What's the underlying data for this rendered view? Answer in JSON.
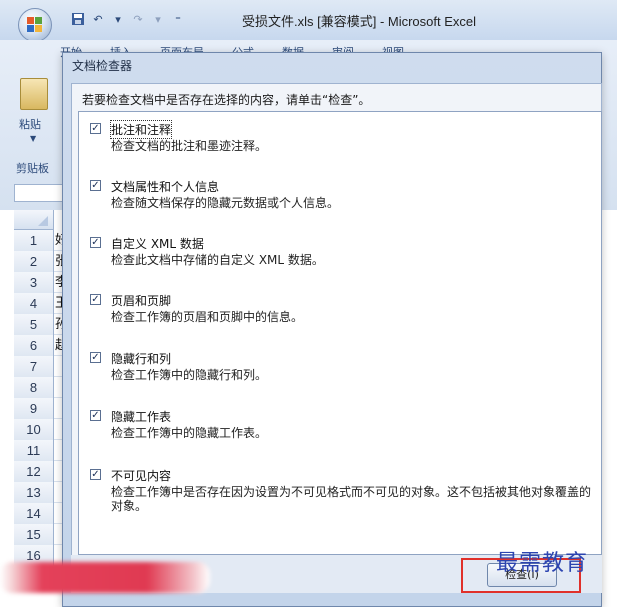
{
  "window": {
    "title": "受损文件.xls [兼容模式] - Microsoft Excel"
  },
  "ribbon": {
    "tabs": [
      "开始",
      "插入",
      "页面布局",
      "公式",
      "数据",
      "审阅",
      "视图"
    ],
    "paste_label": "粘贴",
    "clipboard_label": "剪贴板"
  },
  "sheet": {
    "rows": [
      {
        "num": "1",
        "cell": "好"
      },
      {
        "num": "2",
        "cell": "张"
      },
      {
        "num": "3",
        "cell": "李"
      },
      {
        "num": "4",
        "cell": "王"
      },
      {
        "num": "5",
        "cell": "孙"
      },
      {
        "num": "6",
        "cell": "赵"
      },
      {
        "num": "7",
        "cell": ""
      },
      {
        "num": "8",
        "cell": ""
      },
      {
        "num": "9",
        "cell": ""
      },
      {
        "num": "10",
        "cell": ""
      },
      {
        "num": "11",
        "cell": ""
      },
      {
        "num": "12",
        "cell": ""
      },
      {
        "num": "13",
        "cell": ""
      },
      {
        "num": "14",
        "cell": ""
      },
      {
        "num": "15",
        "cell": ""
      },
      {
        "num": "16",
        "cell": ""
      }
    ]
  },
  "dialog": {
    "title": "文档检查器",
    "instruction": "若要检查文档中是否存在选择的内容，请单击“检查”。",
    "items": [
      {
        "title": "批注和注释",
        "desc": "检查文档的批注和墨迹注释。",
        "checked": true
      },
      {
        "title": "文档属性和个人信息",
        "desc": "检查随文档保存的隐藏元数据或个人信息。",
        "checked": true
      },
      {
        "title": "自定义 XML 数据",
        "desc": "检查此文档中存储的自定义 XML 数据。",
        "checked": true
      },
      {
        "title": "页眉和页脚",
        "desc": "检查工作簿的页眉和页脚中的信息。",
        "checked": true
      },
      {
        "title": "隐藏行和列",
        "desc": "检查工作簿中的隐藏行和列。",
        "checked": true
      },
      {
        "title": "隐藏工作表",
        "desc": "检查工作簿中的隐藏工作表。",
        "checked": true
      },
      {
        "title": "不可见内容",
        "desc": "检查工作簿中是否存在因为设置为不可见格式而不可见的对象。这不包括被其他对象覆盖的对象。",
        "checked": true
      }
    ],
    "inspect_button": "检查(I)"
  },
  "watermark": "最需教育"
}
